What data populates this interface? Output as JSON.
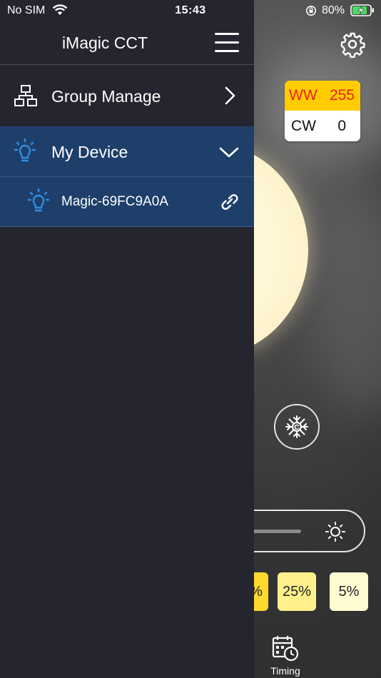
{
  "status_bar": {
    "carrier": "No SIM",
    "time": "15:43",
    "battery_percent": "80%"
  },
  "background_screen": {
    "ww_label": "WW",
    "ww_value": "255",
    "cw_label": "CW",
    "cw_value": "0",
    "presets": [
      "%",
      "25%",
      "5%"
    ],
    "timing_label": "Timing"
  },
  "drawer": {
    "title": "iMagic CCT",
    "group_manage_label": "Group Manage",
    "my_device_label": "My Device",
    "device_name": "Magic-69FC9A0A"
  },
  "colors": {
    "drawer_bg": "#25252f",
    "selected_bg": "#1e3f6a",
    "accent_blue": "#2f8de4",
    "ww_bg": "#ffcc00",
    "ww_text": "#e8231f"
  },
  "icons": {
    "group": "group-hierarchy-icon",
    "bulb": "bulb-icon",
    "link": "link-icon",
    "menu": "hamburger-menu-icon",
    "settings": "gear-icon",
    "snowflake": "snowflake-icon",
    "sun": "sun-icon",
    "timing": "calendar-clock-icon"
  }
}
